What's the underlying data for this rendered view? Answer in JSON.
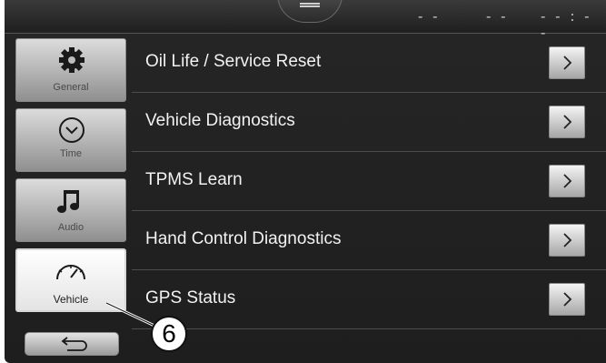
{
  "status": {
    "left": "- -",
    "middle": "- -",
    "clock": "- - : - -"
  },
  "tabs": [
    {
      "label": "General",
      "icon": "gear-icon"
    },
    {
      "label": "Time",
      "icon": "clock-icon"
    },
    {
      "label": "Audio",
      "icon": "music-note-icon"
    },
    {
      "label": "Vehicle",
      "icon": "speedometer-icon",
      "active": true
    }
  ],
  "back_button": {
    "icon": "back-arrow-icon"
  },
  "menu": {
    "items": [
      {
        "label": "Oil Life / Service Reset"
      },
      {
        "label": "Vehicle Diagnostics"
      },
      {
        "label": "TPMS Learn"
      },
      {
        "label": "Hand Control Diagnostics"
      },
      {
        "label": "GPS Status"
      }
    ],
    "arrow_glyph": ">"
  },
  "callout": {
    "number": "6"
  },
  "colors": {
    "background": "#1e1e1e",
    "text": "#f2f2f2",
    "active_tab": "#ffffff"
  }
}
